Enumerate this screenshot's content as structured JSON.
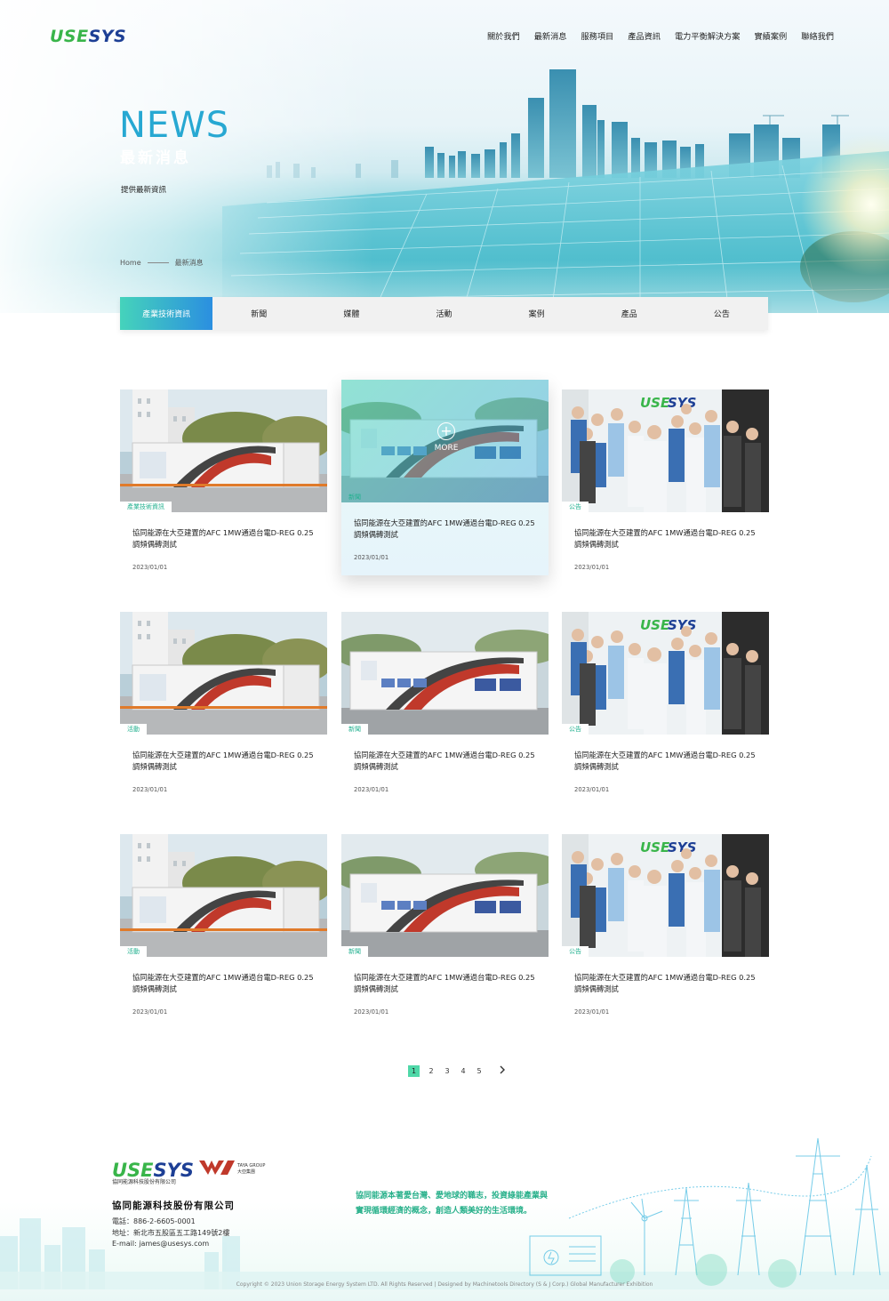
{
  "header": {
    "logo_green": "USE",
    "logo_blue": "SYS",
    "nav": [
      "關於我們",
      "最新消息",
      "服務項目",
      "產品資訊",
      "電力平衡解決方案",
      "實績案例",
      "聯絡我們"
    ]
  },
  "hero": {
    "title": "NEWS",
    "subtitle": "最新消息",
    "description": "提供最新資訊",
    "breadcrumb": [
      "Home",
      "最新消息"
    ]
  },
  "tabs": [
    "產業技術資訊",
    "新聞",
    "媒體",
    "活動",
    "案例",
    "產品",
    "公告"
  ],
  "cards": [
    {
      "tag": "產業技術資訊",
      "title": "協同能源在大亞建置的AFC 1MW通過台電D-REG 0.25調頻偶轉測試",
      "date": "2023/01/01",
      "image": "building-container"
    },
    {
      "tag": "新聞",
      "title": "協同能源在大亞建置的AFC 1MW通過台電D-REG 0.25調頻偶轉測試",
      "date": "2023/01/01",
      "image": "container",
      "more": "MORE"
    },
    {
      "tag": "公告",
      "title": "協同能源在大亞建置的AFC 1MW通過台電D-REG 0.25調頻偶轉測試",
      "date": "2023/01/01",
      "image": "team"
    },
    {
      "tag": "活動",
      "title": "協同能源在大亞建置的AFC 1MW通過台電D-REG 0.25調頻偶轉測試",
      "date": "2023/01/01",
      "image": "building-container"
    },
    {
      "tag": "新聞",
      "title": "協同能源在大亞建置的AFC 1MW通過台電D-REG 0.25調頻偶轉測試",
      "date": "2023/01/01",
      "image": "container"
    },
    {
      "tag": "公告",
      "title": "協同能源在大亞建置的AFC 1MW通過台電D-REG 0.25調頻偶轉測試",
      "date": "2023/01/01",
      "image": "team"
    },
    {
      "tag": "活動",
      "title": "協同能源在大亞建置的AFC 1MW通過台電D-REG 0.25調頻偶轉測試",
      "date": "2023/01/01",
      "image": "building-container"
    },
    {
      "tag": "新聞",
      "title": "協同能源在大亞建置的AFC 1MW通過台電D-REG 0.25調頻偶轉測試",
      "date": "2023/01/01",
      "image": "container"
    },
    {
      "tag": "公告",
      "title": "協同能源在大亞建置的AFC 1MW通過台電D-REG 0.25調頻偶轉測試",
      "date": "2023/01/01",
      "image": "team"
    }
  ],
  "pagination": {
    "pages": [
      "1",
      "2",
      "3",
      "4",
      "5"
    ],
    "current": "1",
    "next_icon": "chevron-right-icon"
  },
  "footer": {
    "logo_green": "USE",
    "logo_blue": "SYS",
    "logo_sub": "協同能源科技股份有限公司",
    "taya_text_en": "TAYA GROUP",
    "taya_text_zh": "大亞集團",
    "company": "協同能源科技股份有限公司",
    "phone": "電話：886-2-6605-0001",
    "address": "地址：新北市五股區五工路149號2樓",
    "email": "E-mail: james@usesys.com",
    "slogan_1": "協同能源本著愛台灣、愛地球的職志，投資綠能產業與",
    "slogan_2": "實現循環經濟的概念，創造人類美好的生活環境。",
    "copyright": "Copyright © 2023 Union Storage Energy System LTD. All Rights Reserved | Designed by Machinetools Directory (S & J Corp.) Global Manufacturer Exhibition"
  },
  "colors": {
    "accent_green": "#39b54a",
    "accent_blue": "#1d3f95",
    "tag_teal": "#22b08f",
    "tab_gradient_start": "#45d3bb",
    "tab_gradient_end": "#2b8fe0"
  }
}
